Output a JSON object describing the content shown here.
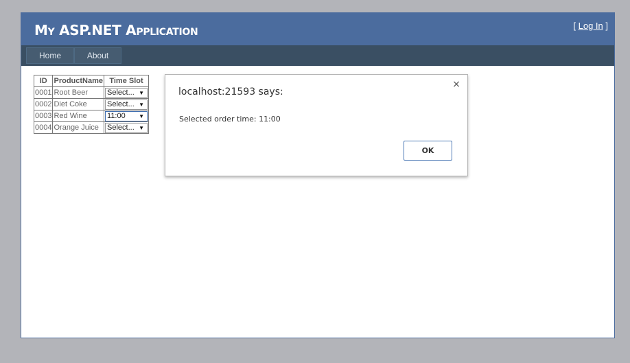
{
  "header": {
    "title": "My ASP.NET Application",
    "login_prefix": "[ ",
    "login_label": "Log In",
    "login_suffix": " ]"
  },
  "menu": {
    "items": [
      {
        "label": "Home"
      },
      {
        "label": "About"
      }
    ]
  },
  "grid": {
    "columns": [
      "ID",
      "ProductName",
      "Time Slot"
    ],
    "rows": [
      {
        "id": "0001",
        "product": "Root Beer",
        "slot": "Select..."
      },
      {
        "id": "0002",
        "product": "Diet Coke",
        "slot": "Select..."
      },
      {
        "id": "0003",
        "product": "Red Wine",
        "slot": "11:00"
      },
      {
        "id": "0004",
        "product": "Orange Juice",
        "slot": "Select..."
      }
    ]
  },
  "dialog": {
    "title": "localhost:21593 says:",
    "message": "Selected order time: 11:00",
    "ok_label": "OK",
    "close_glyph": "×"
  },
  "colors": {
    "background": "#b3b4b9",
    "header": "#4b6c9e",
    "menu_bar": "#3a4f63",
    "menu_item": "#465c71",
    "dialog_button_border": "#4d79b5"
  },
  "icons": {
    "dropdown_arrow": "▼",
    "close": "×"
  }
}
